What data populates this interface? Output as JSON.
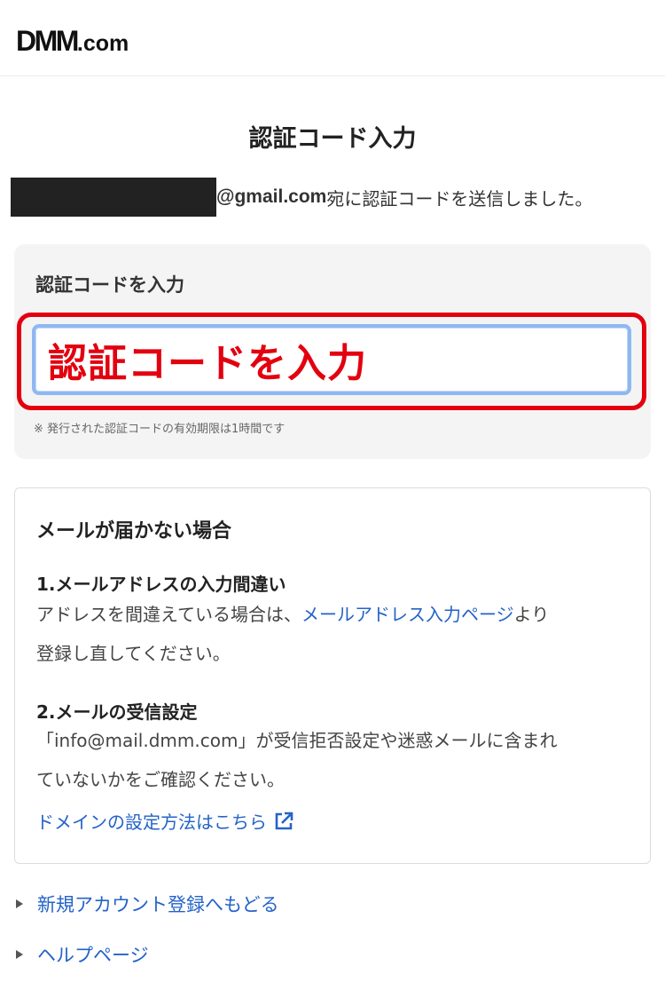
{
  "header": {
    "logo_main": "DMM",
    "logo_suffix": ".com"
  },
  "page_title": "認証コード入力",
  "sent_notice": {
    "email_suffix": "@gmail.com",
    "message": "宛に認証コードを送信しました。"
  },
  "code_form": {
    "label": "認証コードを入力",
    "input_overlay_text": "認証コードを入力",
    "note": "※ 発行された認証コードの有効期限は1時間です",
    "highlight_color": "#e3000f"
  },
  "help": {
    "title": "メールが届かない場合",
    "section1": {
      "heading": "1.メールアドレスの入力間違い",
      "text_before": "アドレスを間違えている場合は、",
      "link": "メールアドレス入力ページ",
      "text_after": "より",
      "text_line2": "登録し直してください。"
    },
    "section2": {
      "heading": "2.メールの受信設定",
      "text_line1": "「info@mail.dmm.com」が受信拒否設定や迷惑メールに含まれ",
      "text_line2": "ていないかをご確認ください。",
      "link": "ドメインの設定方法はこちら"
    }
  },
  "footer_links": [
    {
      "label": "新規アカウント登録へもどる"
    },
    {
      "label": "ヘルプページ"
    }
  ],
  "colors": {
    "link": "#2463c8",
    "accent_red": "#e3000f",
    "input_focus": "#8fb8f2"
  }
}
